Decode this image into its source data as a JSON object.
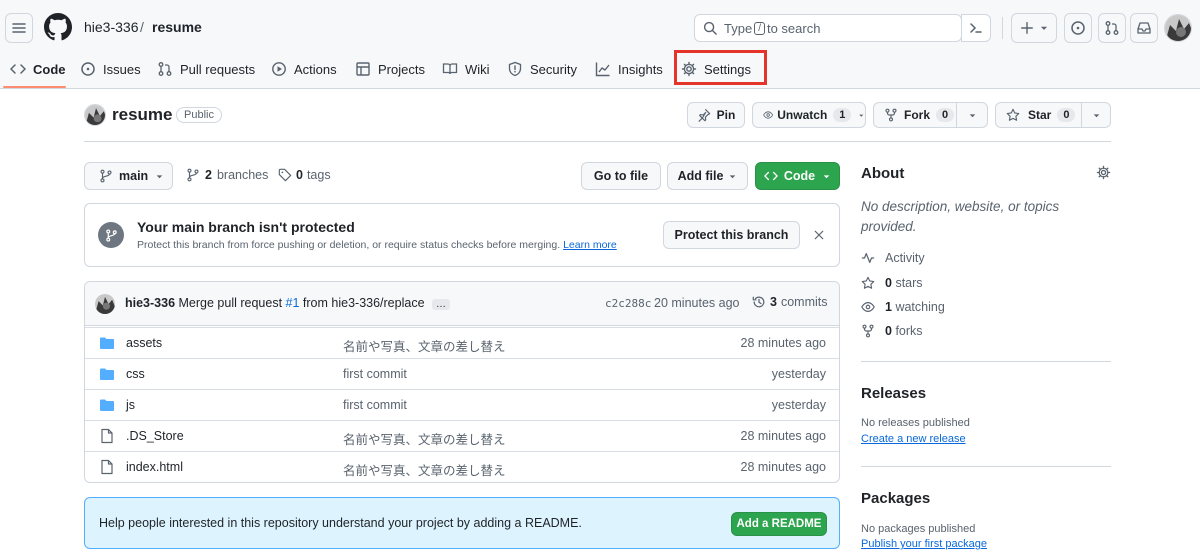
{
  "header": {
    "owner": "hie3-336",
    "separator": "/",
    "repo": "resume",
    "search_prefix": "Type",
    "search_key": "/",
    "search_suffix": "to search"
  },
  "tabs": [
    {
      "label": "Code",
      "icon": "code-icon"
    },
    {
      "label": "Issues",
      "icon": "issue-opened-icon"
    },
    {
      "label": "Pull requests",
      "icon": "git-pull-request-icon"
    },
    {
      "label": "Actions",
      "icon": "play-icon"
    },
    {
      "label": "Projects",
      "icon": "table-icon"
    },
    {
      "label": "Wiki",
      "icon": "book-icon"
    },
    {
      "label": "Security",
      "icon": "shield-icon"
    },
    {
      "label": "Insights",
      "icon": "graph-icon"
    },
    {
      "label": "Settings",
      "icon": "gear-icon"
    }
  ],
  "repo": {
    "name": "resume",
    "visibility": "Public",
    "pin": "Pin",
    "unwatch": "Unwatch",
    "watch_count": "1",
    "fork": "Fork",
    "fork_count": "0",
    "star": "Star",
    "star_count": "0"
  },
  "branchbar": {
    "branch": "main",
    "branches_count": "2",
    "branches_label": "branches",
    "tags_count": "0",
    "tags_label": "tags",
    "go_to_file": "Go to file",
    "add_file": "Add file",
    "code": "Code"
  },
  "protect": {
    "title": "Your main branch isn't protected",
    "desc": "Protect this branch from force pushing or deletion, or require status checks before merging.",
    "learn_more": "Learn more",
    "button": "Protect this branch"
  },
  "commit": {
    "author": "hie3-336",
    "message_prefix": "Merge pull request",
    "pr": "#1",
    "message_suffix": "from hie3-336/replace",
    "more": "…",
    "sha": "c2c288c",
    "time": "20 minutes ago",
    "commits_count": "3",
    "commits_label": "commits"
  },
  "files": [
    {
      "name": "assets",
      "type": "folder",
      "message": "名前や写真、文章の差し替え",
      "time": "28 minutes ago"
    },
    {
      "name": "css",
      "type": "folder",
      "message": "first commit",
      "time": "yesterday"
    },
    {
      "name": "js",
      "type": "folder",
      "message": "first commit",
      "time": "yesterday"
    },
    {
      "name": ".DS_Store",
      "type": "file",
      "message": "名前や写真、文章の差し替え",
      "time": "28 minutes ago"
    },
    {
      "name": "index.html",
      "type": "file",
      "message": "名前や写真、文章の差し替え",
      "time": "28 minutes ago"
    }
  ],
  "readme": {
    "text": "Help people interested in this repository understand your project by adding a README.",
    "button": "Add a README"
  },
  "about": {
    "title": "About",
    "description": "No description, website, or topics provided.",
    "activity": "Activity",
    "stars_count": "0",
    "stars_label": "stars",
    "watching_count": "1",
    "watching_label": "watching",
    "forks_count": "0",
    "forks_label": "forks"
  },
  "releases": {
    "title": "Releases",
    "empty": "No releases published",
    "link": "Create a new release"
  },
  "packages": {
    "title": "Packages",
    "empty": "No packages published",
    "link": "Publish your first package"
  },
  "colors": {
    "accent_green": "#2da44e",
    "link_blue": "#0969da",
    "highlight_red": "#e5352a",
    "tab_underline": "#fd8c73",
    "folder_blue": "#54aeff"
  }
}
